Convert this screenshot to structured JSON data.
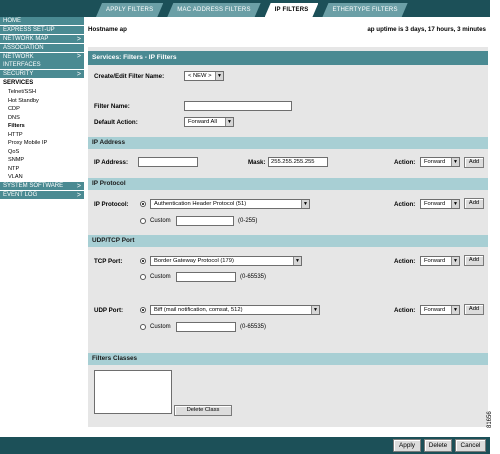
{
  "tabs": [
    {
      "label": "APPLY FILTERS"
    },
    {
      "label": "MAC ADDRESS FILTERS"
    },
    {
      "label": "IP FILTERS"
    },
    {
      "label": "ETHERTYPE FILTERS"
    }
  ],
  "nav": {
    "home": "HOME",
    "express_setup": "EXPRESS SET-UP",
    "network_map": "NETWORK MAP",
    "association": "ASSOCIATION",
    "network_interfaces": [
      "NETWORK",
      "INTERFACES"
    ],
    "security": "SECURITY",
    "services": "SERVICES",
    "services_sub": [
      "Telnet/SSH",
      "Hot Standby",
      "CDP",
      "DNS",
      "Filters",
      "HTTP",
      "Proxy Mobile IP",
      "QoS",
      "SNMP",
      "NTP",
      "VLAN"
    ],
    "system_software": "SYSTEM SOFTWARE",
    "event_log": "EVENT LOG",
    "chevron": ">"
  },
  "header": {
    "hostname": "Hostname  ap",
    "uptime": "ap uptime is 3 days, 17 hours, 3 minutes"
  },
  "page_title": "Services: Filters - IP Filters",
  "form": {
    "create_edit_label": "Create/Edit Filter Name:",
    "create_edit_value": "< NEW >",
    "filter_name_label": "Filter Name:",
    "filter_name_value": "",
    "default_action_label": "Default Action:",
    "default_action_value": "Forward All"
  },
  "ip_address_section": {
    "title": "IP Address",
    "ip_label": "IP Address:",
    "ip_value": "",
    "mask_label": "Mask:",
    "mask_value": "255.255.255.255",
    "action_label": "Action:",
    "action_value": "Forward",
    "add_label": "Add"
  },
  "ip_protocol_section": {
    "title": "IP Protocol",
    "protocol_label": "IP Protocol:",
    "protocol_value": "Authentication Header Protocol (51)",
    "custom_label": "Custom",
    "custom_range": "(0-255)",
    "action_label": "Action:",
    "action_value": "Forward",
    "add_label": "Add"
  },
  "udp_tcp_section": {
    "title": "UDP/TCP Port",
    "tcp_label": "TCP Port:",
    "tcp_value": "Border Gateway Protocol (179)",
    "tcp_custom_label": "Custom",
    "tcp_custom_range": "(0-65535)",
    "tcp_action_label": "Action:",
    "tcp_action_value": "Forward",
    "tcp_add_label": "Add",
    "udp_label": "UDP Port:",
    "udp_value": "Biff (mail notification, comsat, 512)",
    "udp_custom_label": "Custom",
    "udp_custom_range": "(0-65535)",
    "udp_action_label": "Action:",
    "udp_action_value": "Forward",
    "udp_add_label": "Add"
  },
  "filters_classes_section": {
    "title": "Filters Classes",
    "delete_class_label": "Delete Class"
  },
  "footer": {
    "apply": "Apply",
    "delete": "Delete",
    "cancel": "Cancel"
  },
  "figure_id": "81656",
  "colors": {
    "dark_teal": "#1c5058",
    "nav_teal": "#4a8a92",
    "section_band": "#a8cfd4",
    "panel_gray": "#e6e6e6"
  }
}
